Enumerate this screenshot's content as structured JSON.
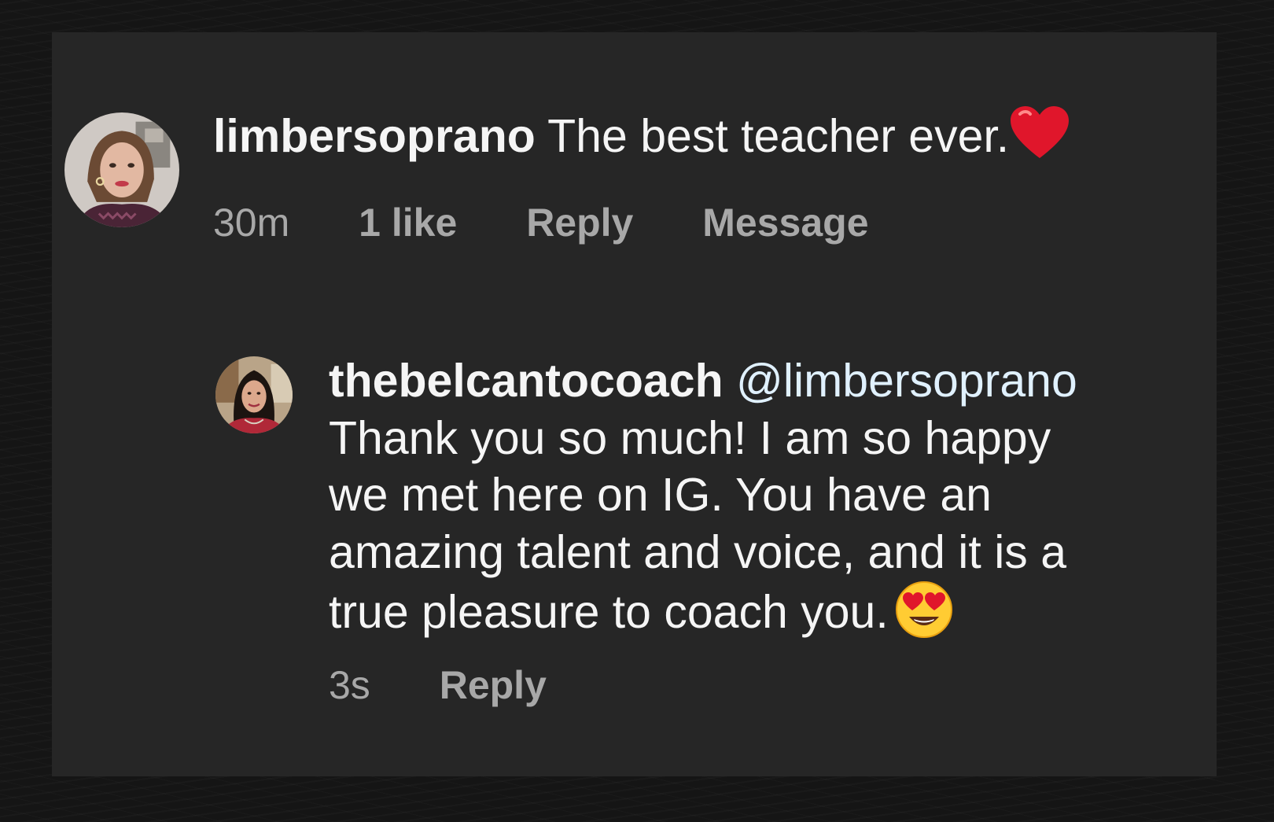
{
  "comment": {
    "username": "limbersoprano",
    "text": "The best teacher ever.",
    "emoji": "red-heart-icon",
    "time": "30m",
    "likes": "1 like",
    "reply_label": "Reply",
    "message_label": "Message"
  },
  "reply": {
    "username": "thebelcantocoach",
    "mention": "@limbersoprano",
    "lines": [
      "Thank you so much! I am so happy",
      "we met here on IG. You have an",
      "amazing talent and voice, and it is a",
      "true pleasure to coach you."
    ],
    "emoji": "heart-eyes-face-icon",
    "time": "3s",
    "reply_label": "Reply"
  },
  "colors": {
    "card_background": "#262626",
    "primary_text": "#f5f5f5",
    "secondary_text": "#a8a8a8",
    "mention_text": "#e0f1ff",
    "heart": "#e0162b"
  }
}
